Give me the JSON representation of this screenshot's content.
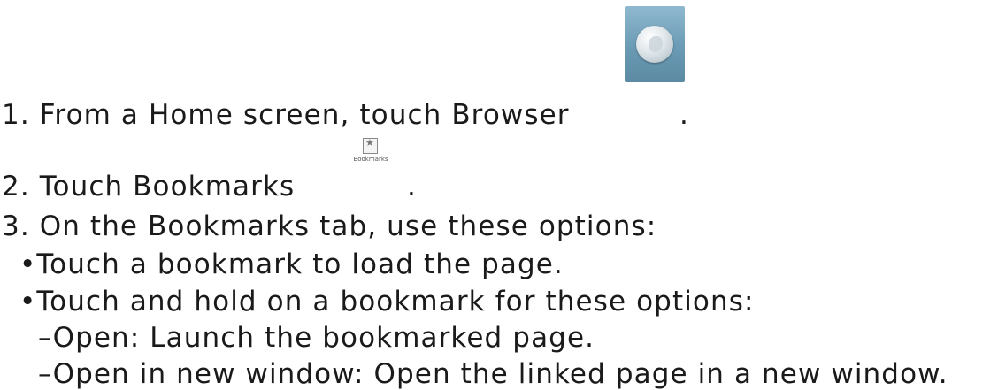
{
  "steps": [
    {
      "text": "1. From a Home screen, touch Browser",
      "suffix": "."
    },
    {
      "text": "2. Touch Bookmarks",
      "suffix": "."
    },
    {
      "text": "3. On the Bookmarks tab, use these options:"
    }
  ],
  "bullets": [
    "•Touch a bookmark to load the page.",
    "•Touch and hold on a bookmark for these options:"
  ],
  "sub_items": [
    "–Open: Launch the bookmarked page.",
    "–Open in new window: Open the linked page in a new window."
  ],
  "icons": {
    "browser": "browser-globe-icon",
    "bookmarks": "bookmarks-icon",
    "bookmarks_caption": "Bookmarks"
  }
}
